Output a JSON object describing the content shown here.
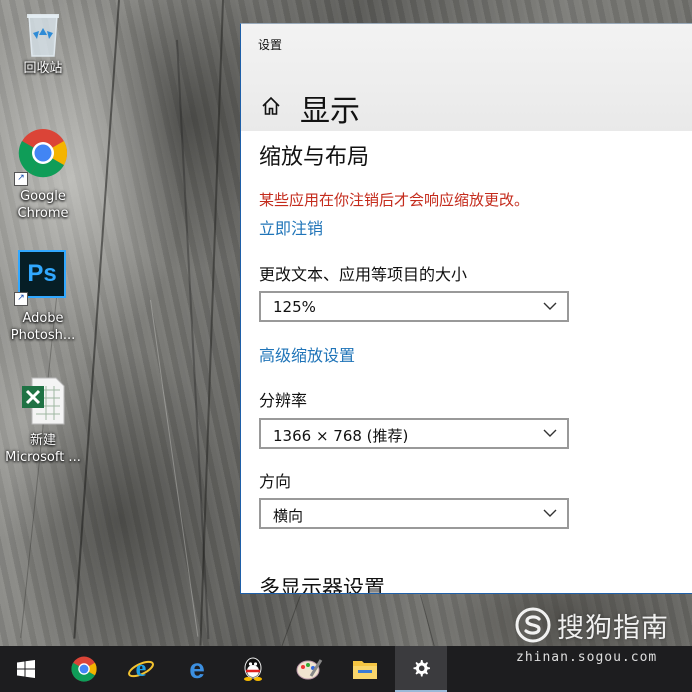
{
  "desktop": {
    "icons": [
      {
        "label": "回收站",
        "icon": "recycle-bin-icon"
      },
      {
        "label": "Google Chrome",
        "icon": "chrome-icon"
      },
      {
        "label": "Adobe Photosh...",
        "icon": "photoshop-icon",
        "badge": "Ps"
      },
      {
        "label": "新建 Microsoft ...",
        "icon": "excel-file-icon"
      }
    ]
  },
  "settings": {
    "window_title": "设置",
    "page_title": "显示",
    "section_title": "缩放与布局",
    "warning": "某些应用在你注销后才会响应缩放更改。",
    "sign_out_link": "立即注销",
    "scale_label": "更改文本、应用等项目的大小",
    "scale_value": "125%",
    "advanced_scaling_link": "高级缩放设置",
    "resolution_label": "分辨率",
    "resolution_value": "1366 × 768 (推荐)",
    "orientation_label": "方向",
    "orientation_value": "横向",
    "multi_display_title": "多显示器设置"
  },
  "taskbar": {
    "items": [
      "start-icon",
      "chrome-icon",
      "internet-explorer-icon",
      "edge-icon",
      "qq-icon",
      "paint-icon",
      "file-explorer-icon",
      "settings-gear-icon"
    ],
    "active": "settings-gear-icon"
  },
  "watermark": {
    "brand": "搜狗指南",
    "url": "zhinan.sogou.com"
  },
  "colors": {
    "warning": "#c42b1c",
    "link": "#1f74b8",
    "taskbar": "#1d1d1f",
    "window_border": "#1e5fa8"
  }
}
